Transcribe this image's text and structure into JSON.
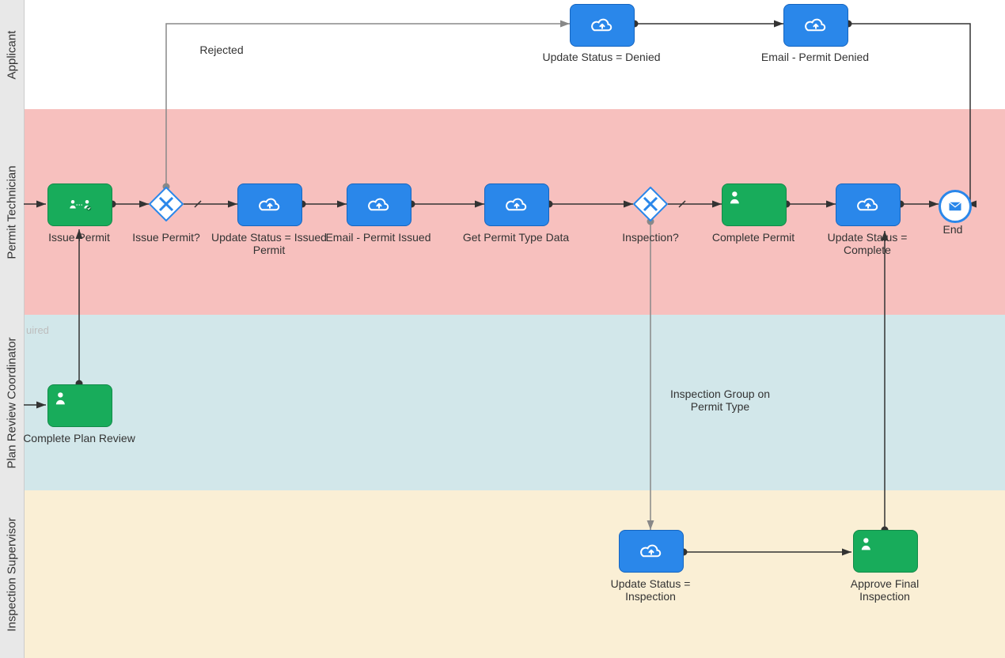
{
  "lanes": {
    "applicant": {
      "label": "Applicant"
    },
    "permit_tech": {
      "label": "Permit Technician"
    },
    "plan_review": {
      "label": "Plan Review Coordinator"
    },
    "inspection": {
      "label": "Inspection Supervisor"
    }
  },
  "nodes": {
    "issue_permit_task": "Issue Permit",
    "issue_permit_gateway": "Issue Permit?",
    "update_issued": "Update Status = Issued Permit",
    "email_issued": "Email - Permit Issued",
    "get_permit_type": "Get Permit Type Data",
    "inspection_gateway": "Inspection?",
    "complete_permit": "Complete Permit",
    "update_complete": "Update Status = Complete",
    "end": "End",
    "update_denied": "Update Status = Denied",
    "email_denied": "Email - Permit Denied",
    "complete_plan_review": "Complete Plan Review",
    "update_inspection": "Update Status = Inspection",
    "approve_final_inspection": "Approve Final Inspection"
  },
  "edges": {
    "rejected": "Rejected",
    "inspection_group": "Inspection Group on Permit Type"
  },
  "watermark": "uired"
}
